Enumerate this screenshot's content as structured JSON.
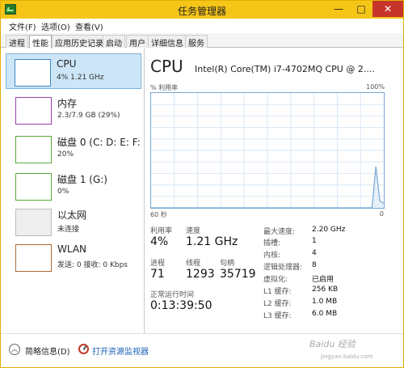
{
  "window": {
    "title": "任务管理器"
  },
  "menu": [
    "文件(F)",
    "选项(O)",
    "查看(V)"
  ],
  "tabs": [
    "进程",
    "性能",
    "应用历史记录",
    "启动",
    "用户",
    "详细信息",
    "服务"
  ],
  "active_tab": "性能",
  "sidebar": {
    "items": [
      {
        "title": "CPU",
        "sub": "4% 1.21 GHz"
      },
      {
        "title": "内存",
        "sub": "2.3/7.9 GB (29%)"
      },
      {
        "title": "磁盘 0 (C: D: E: F:",
        "sub": "20%"
      },
      {
        "title": "磁盘 1 (G:)",
        "sub": "0%"
      },
      {
        "title": "以太网",
        "sub": "未连接"
      },
      {
        "title": "WLAN",
        "sub": "发送: 0 接收: 0 Kbps"
      }
    ]
  },
  "detail": {
    "heading": "CPU",
    "cpu_name": "Intel(R) Core(TM) i7-4702MQ CPU @ 2....",
    "util_label": "% 利用率",
    "max_label": "100%",
    "time_left_label": "60 秒",
    "time_right_label": "0",
    "graph_color": "#76a7d2",
    "graph_series": [
      0,
      0,
      0,
      0,
      0,
      0,
      0,
      0,
      0,
      0,
      0,
      0,
      0,
      0,
      0,
      0,
      0,
      0,
      0,
      0,
      0,
      0,
      0,
      0,
      0,
      0,
      0,
      0,
      0,
      0,
      0,
      0,
      0,
      0,
      0,
      0,
      0,
      0,
      0,
      0,
      0,
      0,
      0,
      0,
      0,
      0,
      0,
      0,
      0,
      0,
      0,
      0,
      0,
      0,
      0,
      0,
      0,
      36,
      6,
      4
    ],
    "stats": {
      "util_label": "利用率",
      "util_value": "4%",
      "speed_label": "速度",
      "speed_value": "1.21 GHz",
      "proc_label": "进程",
      "proc_value": "71",
      "thread_label": "线程",
      "thread_value": "1293",
      "handle_label": "句柄",
      "handle_value": "35719",
      "uptime_label": "正常运行时间",
      "uptime_value": "0:13:39:50"
    },
    "specs": [
      {
        "k": "最大速度:",
        "v": "2.20 GHz"
      },
      {
        "k": "插槽:",
        "v": "1"
      },
      {
        "k": "内核:",
        "v": "4"
      },
      {
        "k": "逻辑处理器:",
        "v": "8"
      },
      {
        "k": "虚拟化:",
        "v": "已启用"
      },
      {
        "k": "L1 缓存:",
        "v": "256 KB"
      },
      {
        "k": "L2 缓存:",
        "v": "1.0 MB"
      },
      {
        "k": "L3 缓存:",
        "v": "6.0 MB"
      }
    ]
  },
  "footer": {
    "fewer_details": "简略信息(D)",
    "resource_monitor": "打开资源监视器"
  },
  "watermark": {
    "main": "Baidu 经验",
    "sub": "jingyan.baidu.com"
  }
}
